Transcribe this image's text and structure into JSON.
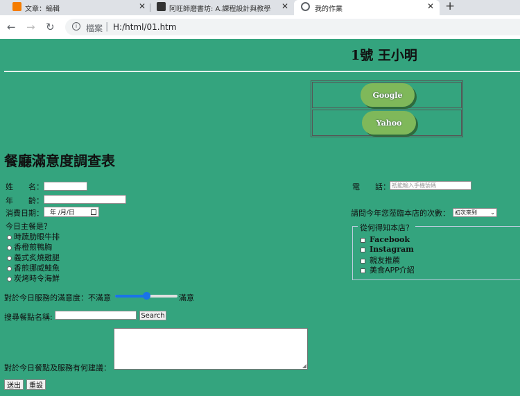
{
  "browser": {
    "tabs": [
      {
        "title": "文章：編輯",
        "icon": "blogger-icon",
        "color": "#f57c00"
      },
      {
        "title": "阿旺師磨書坊: A.課程設計與教學",
        "icon": "book-icon",
        "color": "#333333"
      },
      {
        "title": "我的作業",
        "icon": "globe-icon",
        "color": "#5f6368"
      }
    ],
    "site_info": "檔案",
    "url": "H:/html/01.htm"
  },
  "page": {
    "heading": "1號 王小明",
    "links": [
      "Google",
      "Yahoo"
    ],
    "form_title": "餐廳滿意度調查表",
    "name_label": "姓　　名：",
    "age_label": "年　　齡：",
    "date_label": "消費日期：",
    "date_placeholder": "年 /月/日",
    "main_course_label": "今日主餐是？",
    "main_courses": [
      "時蔬肋眼牛排",
      "香橙煎鴨胸",
      "義式炙燒雞腿",
      "香煎挪威鮭魚",
      "炭烤時令海鮮"
    ],
    "phone_label": "電　　話：",
    "phone_placeholder": "祇能輸入手機號碼",
    "visits_label": "請問今年您蒞臨本店的次數：",
    "visits_selected": "初次來到",
    "source_legend": "從何得知本店？",
    "sources": [
      "Facebook",
      "Instagram",
      "親友推薦",
      "美食APP介紹"
    ],
    "satisfaction_label": "對於今日服務的滿意度：",
    "satisfaction_min": "不滿意",
    "satisfaction_max": "滿意",
    "satisfaction_value": 0.5,
    "search_label": "搜尋餐點名稱:",
    "search_button": "Search",
    "suggestion_label": "對於今日餐點及服務有何建議：",
    "submit_button": "送出",
    "reset_button": "重設"
  },
  "colors": {
    "page_bg": "#34a47e",
    "pill": "#7fb85a",
    "slider": "#1a73e8"
  }
}
